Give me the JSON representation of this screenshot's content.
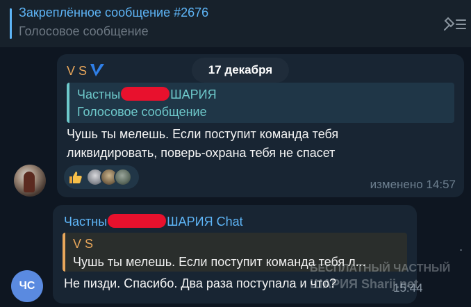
{
  "pinned": {
    "title": "Закреплённое сообщение #2676",
    "subtitle": "Голосовое сообщение",
    "icon": "pin-list-icon"
  },
  "date_separator": "17 декабря",
  "messages": [
    {
      "sender": "V S",
      "verified_icon": "checkmark-icon",
      "reply": {
        "name_prefix": "Частны",
        "name_suffix": "ШАРИЯ",
        "text": "Голосовое сообщение"
      },
      "lines": [
        "Чушь ты мелешь. Если поступит команда тебя",
        "ликвидировать, поверь-охрана тебя не спасет"
      ],
      "reactions": [
        "thumbs-up-icon",
        "reactor-avatar",
        "reactor-avatar",
        "reactor-avatar"
      ],
      "time": "изменено 14:57"
    },
    {
      "sender_prefix": "Частны",
      "sender_suffix": "ШАРИЯ Chat",
      "reply": {
        "name": "V S",
        "text": "Чушь ты мелешь. Если поступит команда тебя л..."
      },
      "text": "Не пизди. Спасибо. Два раза поступала и что?",
      "time": "15:44",
      "avatar_initials": "ЧС"
    }
  ],
  "watermark": {
    "line1": "БЕСПЛАТНЫЙ ЧАСТНЫЙ",
    "line2": "ШАРИЯ  Sharij.net"
  },
  "colors": {
    "background": "#0e1621",
    "bubble": "#182533",
    "accent_blue": "#5eb5f7",
    "accent_orange": "#e9a75b",
    "accent_teal": "#6ec9cb",
    "redaction": "#e8112d"
  }
}
